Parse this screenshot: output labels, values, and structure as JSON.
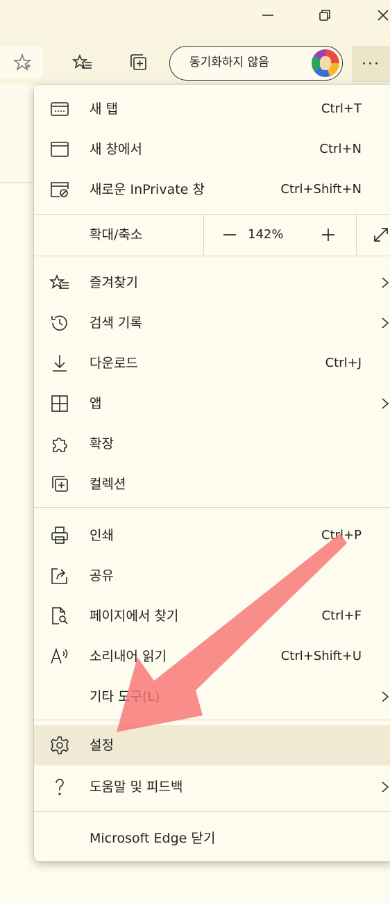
{
  "titlebar": {
    "minimize_icon": "minimize-icon",
    "restore_icon": "restore-icon",
    "close_icon": "close-icon"
  },
  "toolbar": {
    "favorite_icon": "star-outline-icon",
    "favorites_icon": "favorites-list-icon",
    "collections_icon": "collections-icon",
    "sync_label": "동기화하지 않음",
    "more_label": "···"
  },
  "menu": {
    "new_tab": {
      "label": "새 탭",
      "shortcut": "Ctrl+T"
    },
    "new_window": {
      "label": "새 창에서",
      "shortcut": "Ctrl+N"
    },
    "new_inprivate": {
      "label": "새로운 InPrivate 창",
      "shortcut": "Ctrl+Shift+N"
    },
    "zoom": {
      "label": "확대/축소",
      "value": "142%"
    },
    "favorites": {
      "label": "즐겨찾기"
    },
    "history": {
      "label": "검색 기록"
    },
    "downloads": {
      "label": "다운로드",
      "shortcut": "Ctrl+J"
    },
    "apps": {
      "label": "앱"
    },
    "extensions": {
      "label": "확장"
    },
    "collections": {
      "label": "컬렉션"
    },
    "print": {
      "label": "인쇄",
      "shortcut": "Ctrl+P"
    },
    "share": {
      "label": "공유"
    },
    "find": {
      "label": "페이지에서 찾기",
      "shortcut": "Ctrl+F"
    },
    "read_aloud": {
      "label": "소리내어 읽기",
      "shortcut": "Ctrl+Shift+U"
    },
    "more_tools": {
      "label": "기타 도구(L)"
    },
    "settings": {
      "label": "설정"
    },
    "help": {
      "label": "도움말 및 피드백"
    },
    "close_edge": {
      "label": "Microsoft Edge 닫기"
    }
  },
  "annotation": {
    "arrow_color": "#f77474",
    "highlight_color": "#f0ead4"
  }
}
